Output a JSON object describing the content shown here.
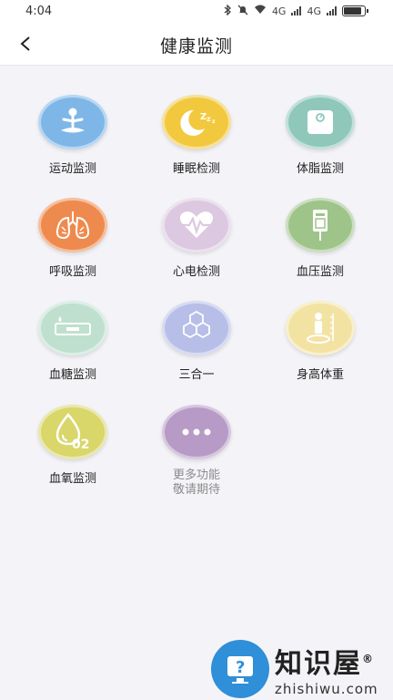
{
  "statusbar": {
    "time": "4:04",
    "net1": "4G",
    "net2": "4G"
  },
  "header": {
    "title": "健康监测"
  },
  "tiles": [
    {
      "label": "运动监测",
      "color": "#7fb6e8",
      "icon": "yoga-icon"
    },
    {
      "label": "睡眠检测",
      "color": "#f2c93e",
      "icon": "moon-icon"
    },
    {
      "label": "体脂监测",
      "color": "#8fc7bb",
      "icon": "scale-icon"
    },
    {
      "label": "呼吸监测",
      "color": "#ef8a4e",
      "icon": "lungs-icon"
    },
    {
      "label": "心电检测",
      "color": "#dcc8e0",
      "icon": "heart-ecg-icon"
    },
    {
      "label": "血压监测",
      "color": "#9fc48a",
      "icon": "blood-pressure-icon"
    },
    {
      "label": "血糖监测",
      "color": "#bfe0cf",
      "icon": "glucose-strip-icon"
    },
    {
      "label": "三合一",
      "color": "#b7bfe8",
      "icon": "hexagon-icon"
    },
    {
      "label": "身高体重",
      "color": "#f3e3a3",
      "icon": "height-icon"
    },
    {
      "label": "血氧监测",
      "color": "#d9d66a",
      "icon": "oxygen-drop-icon"
    },
    {
      "label_line1": "更多功能",
      "label_line2": "敬请期待",
      "color": "#b79ac6",
      "icon": "more-dots-icon"
    }
  ],
  "watermark": {
    "cn": "知识屋",
    "en": "zhishiwu.com",
    "registered": "®"
  }
}
